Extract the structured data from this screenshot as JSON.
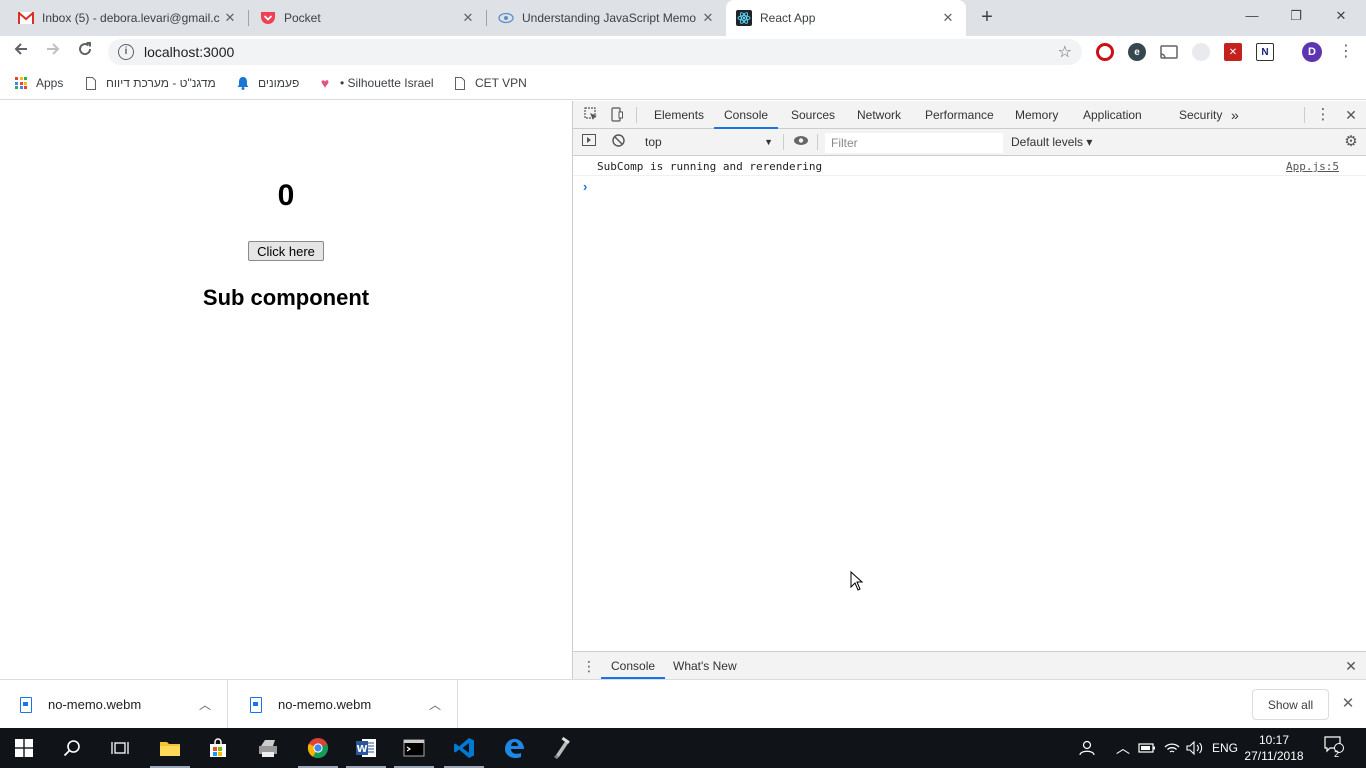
{
  "browser": {
    "tabs": [
      {
        "title": "Inbox (5) - debora.levari@gmail.c",
        "icon": "gmail-icon"
      },
      {
        "title": "Pocket",
        "icon": "pocket-icon"
      },
      {
        "title": "Understanding JavaScript Memo",
        "icon": "eye-icon"
      },
      {
        "title": "React App",
        "icon": "react-icon"
      }
    ],
    "new_tab_symbol": "+",
    "address": "localhost:3000",
    "profile_initial": "D",
    "bookmarks": [
      {
        "label": "Apps"
      },
      {
        "label": "מדגנ\"ט - מערכת דיווח"
      },
      {
        "label": "פעמונים"
      },
      {
        "label": "• Silhouette Israel"
      },
      {
        "label": "CET VPN"
      }
    ]
  },
  "page": {
    "counter": "0",
    "button_label": "Click here",
    "sub_heading": "Sub component"
  },
  "devtools": {
    "tabs": [
      "Elements",
      "Console",
      "Sources",
      "Network",
      "Performance",
      "Memory",
      "Application",
      "Security"
    ],
    "more_tabs": "»",
    "context": "top",
    "filter_placeholder": "Filter",
    "levels": "Default levels ▾",
    "messages": [
      {
        "text": "SubComp is running and rerendering",
        "source": "App.js:5"
      }
    ],
    "prompt": "›",
    "drawer_tabs": [
      "Console",
      "What's New"
    ]
  },
  "downloads": {
    "items": [
      {
        "name": "no-memo.webm"
      },
      {
        "name": "no-memo.webm"
      }
    ],
    "show_all": "Show all"
  },
  "taskbar": {
    "language": "ENG",
    "time": "10:17",
    "date": "27/11/2018",
    "notifications": "2"
  },
  "colors": {
    "accent": "#1a73e8",
    "tabstrip": "#dee1e6",
    "taskbar": "#101418"
  }
}
